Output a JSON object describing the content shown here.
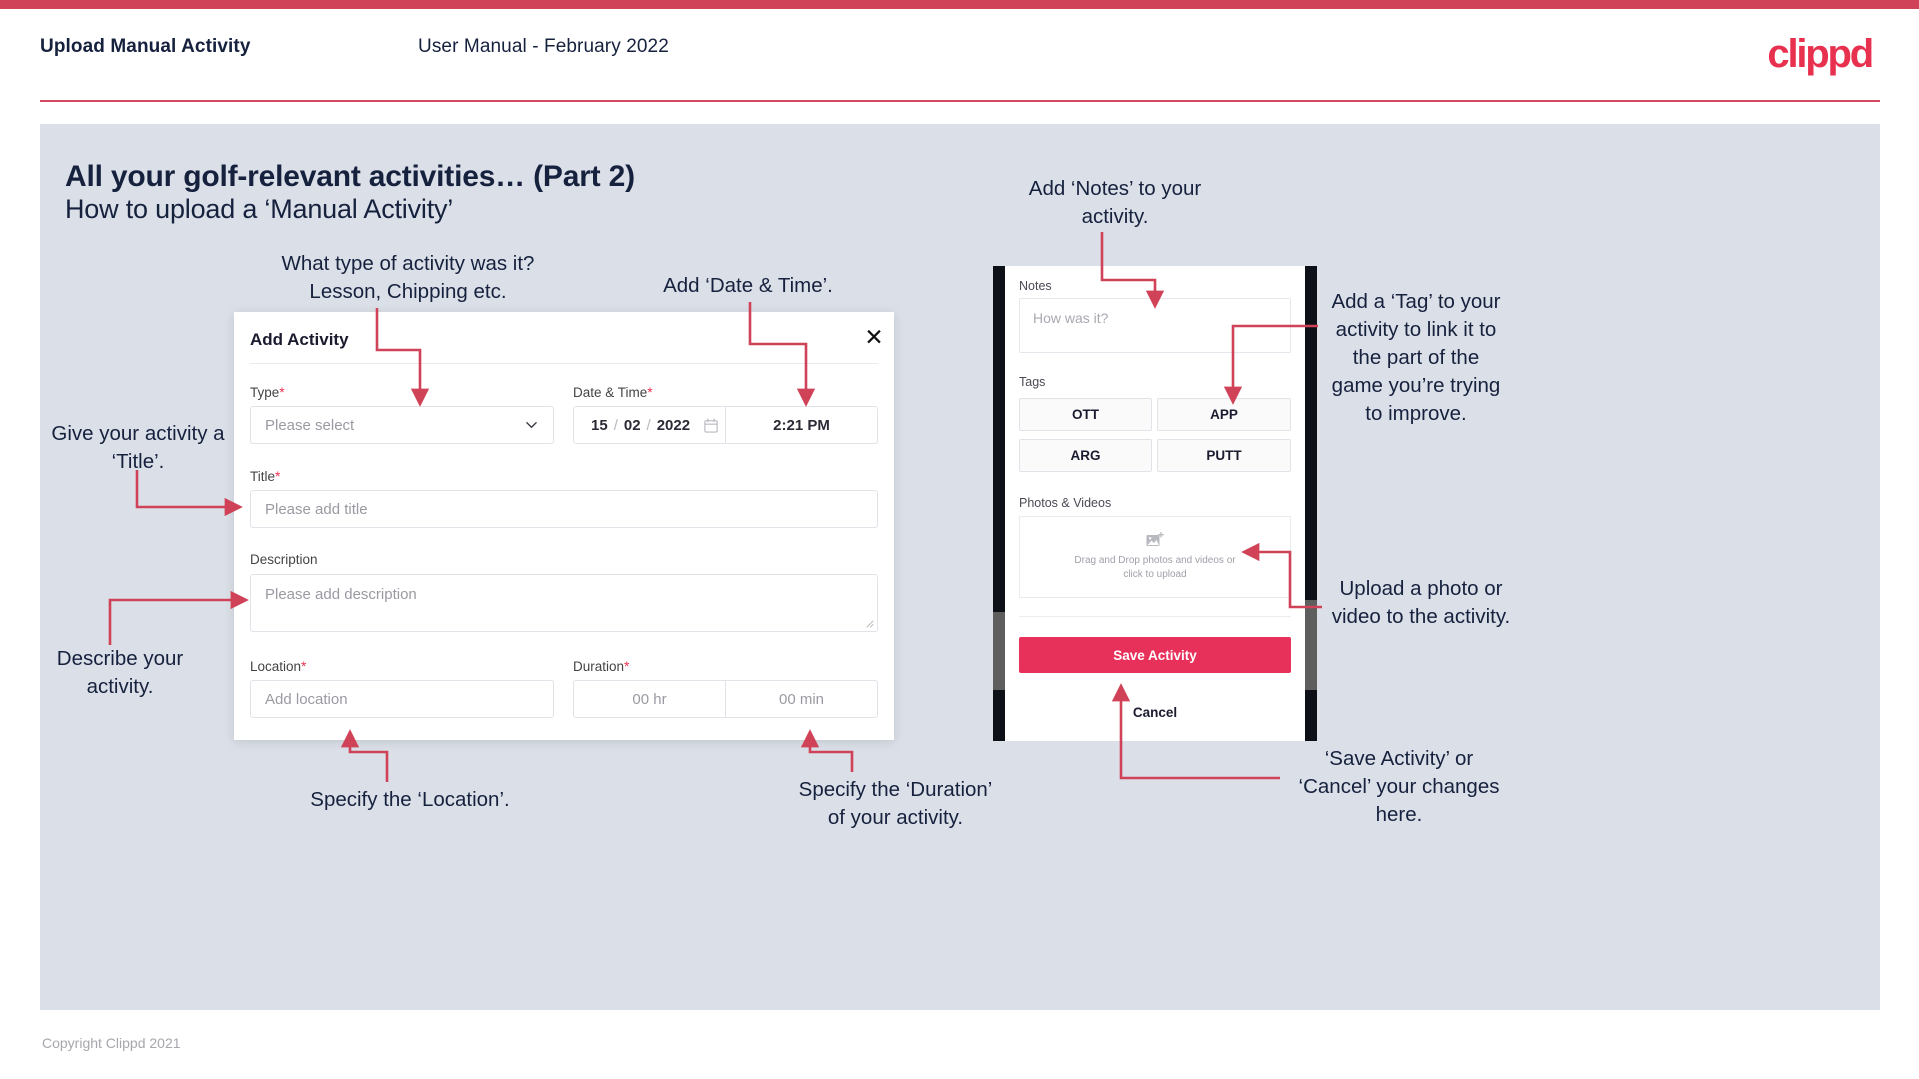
{
  "header": {
    "left_title": "Upload Manual Activity",
    "center_title": "User Manual - February 2022",
    "logo": "clippd"
  },
  "slide": {
    "title": "All your golf-relevant activities… (Part 2)",
    "subtitle": "How to upload a ‘Manual Activity’"
  },
  "annotations": {
    "type": "What type of activity was it?\nLesson, Chipping etc.",
    "datetime": "Add ‘Date & Time’.",
    "notes": "Add ‘Notes’ to your\nactivity.",
    "tag": "Add a ‘Tag’ to your\nactivity to link it to\nthe part of the\ngame you’re trying\nto improve.",
    "title_field": "Give your activity a\n‘Title’.",
    "description": "Describe your\nactivity.",
    "location": "Specify the ‘Location’.",
    "duration": "Specify the ‘Duration’\nof your activity.",
    "upload": "Upload a photo or\nvideo to the activity.",
    "save_cancel": "‘Save Activity’ or\n‘Cancel’ your changes\nhere."
  },
  "dialog": {
    "title": "Add Activity",
    "close_icon": "close-icon",
    "fields": {
      "type": {
        "label": "Type",
        "required": "*",
        "placeholder": "Please select",
        "icon": "chevron-down-icon"
      },
      "datetime": {
        "label": "Date & Time",
        "required": "*",
        "day": "15",
        "month": "02",
        "year": "2022",
        "sep": "/",
        "time": "2:21 PM",
        "icon": "calendar-icon"
      },
      "title": {
        "label": "Title",
        "required": "*",
        "placeholder": "Please add title"
      },
      "description": {
        "label": "Description",
        "required": "",
        "placeholder": "Please add description"
      },
      "location": {
        "label": "Location",
        "required": "*",
        "placeholder": "Add location"
      },
      "duration": {
        "label": "Duration",
        "required": "*",
        "hours_placeholder": "00 hr",
        "minutes_placeholder": "00 min"
      }
    }
  },
  "phone": {
    "notes": {
      "label": "Notes",
      "placeholder": "How was it?"
    },
    "tags": {
      "label": "Tags",
      "items": [
        "OTT",
        "APP",
        "ARG",
        "PUTT"
      ]
    },
    "photos": {
      "label": "Photos & Videos",
      "dropzone_text": "Drag and Drop photos and videos or\nclick to upload",
      "icon": "add-image-icon"
    },
    "save_label": "Save Activity",
    "cancel_label": "Cancel"
  },
  "footer": {
    "copyright": "Copyright Clippd 2021"
  },
  "colors": {
    "brand_pink": "#e8314f",
    "save_pink": "#e8315a",
    "panel_bg": "#dbe0e8",
    "text_navy": "#16213e",
    "arrow": "#cf4257"
  }
}
